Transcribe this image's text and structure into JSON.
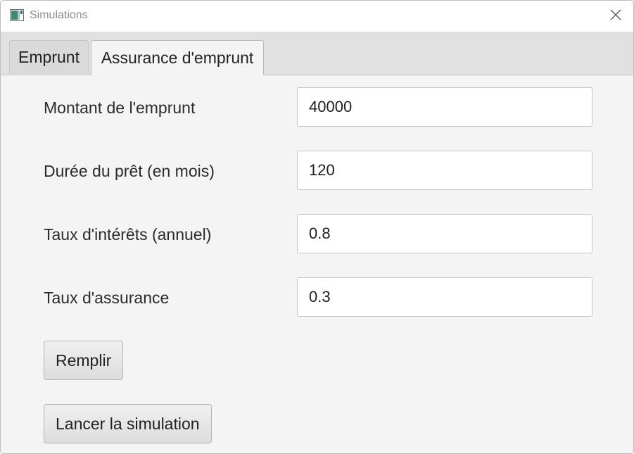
{
  "window": {
    "title": "Simulations",
    "app_icon": "java-window-icon",
    "close_icon": "close-icon"
  },
  "tabs": [
    {
      "label": "Emprunt",
      "selected": false
    },
    {
      "label": "Assurance d'emprunt",
      "selected": true
    }
  ],
  "form": {
    "montant": {
      "label": "Montant de l'emprunt",
      "value": "40000"
    },
    "duree": {
      "label": "Durée du prêt (en mois)",
      "value": "120"
    },
    "taux_interets": {
      "label": "Taux d'intérêts (annuel)",
      "value": "0.8"
    },
    "taux_assurance": {
      "label": "Taux d'assurance",
      "value": "0.3"
    }
  },
  "buttons": {
    "remplir": "Remplir",
    "lancer": "Lancer la simulation"
  }
}
